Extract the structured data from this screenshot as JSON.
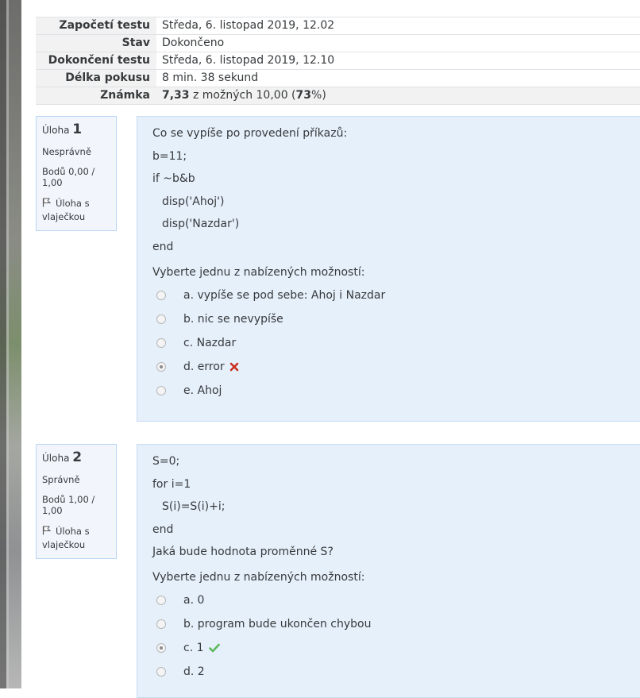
{
  "summary": [
    {
      "label": "Započetí testu",
      "value": "Středa, 6. listopad 2019, 12.02"
    },
    {
      "label": "Stav",
      "value": "Dokončeno"
    },
    {
      "label": "Dokončení testu",
      "value": "Středa, 6. listopad 2019, 12.10"
    },
    {
      "label": "Délka pokusu",
      "value": "8 min. 38 sekund"
    },
    {
      "label": "Známka",
      "value_bold": "7,33",
      "value_mid": " z možných 10,00 (",
      "value_pct": "73",
      "value_end": "%)"
    }
  ],
  "questions": [
    {
      "prefix": "Úloha",
      "number": "1",
      "state": "Nesprávně",
      "grade": "Bodů 0,00 / 1,00",
      "flag": "Úloha s vlaječkou",
      "lines": [
        "Co se vypíše po provedení příkazů:",
        "b=11;",
        "if ~b&b",
        "disp('Ahoj')",
        "disp('Nazdar')",
        "end"
      ],
      "prompt": "Vyberte jednu z nabízených možností:",
      "options": [
        "a. vypíše se pod sebe: Ahoj i Nazdar",
        "b. nic se nevypíše",
        "c. Nazdar",
        "d. error",
        "e. Ahoj"
      ],
      "selected": 3,
      "feedback_icon": "cross-icon",
      "feedback_color": "#ca3120"
    },
    {
      "prefix": "Úloha",
      "number": "2",
      "state": "Správně",
      "grade": "Bodů 1,00 / 1,00",
      "flag": "Úloha s vlaječkou",
      "lines": [
        "S=0;",
        "for i=1",
        "S(i)=S(i)+i;",
        "end",
        "Jaká bude hodnota proměnné S?"
      ],
      "prompt": "Vyberte jednu z nabízených možností:",
      "options": [
        "a. 0",
        "b. program bude ukončen chybou",
        "c. 1",
        "d. 2"
      ],
      "selected": 2,
      "feedback_icon": "check-icon",
      "feedback_color": "#5cb85c"
    }
  ]
}
